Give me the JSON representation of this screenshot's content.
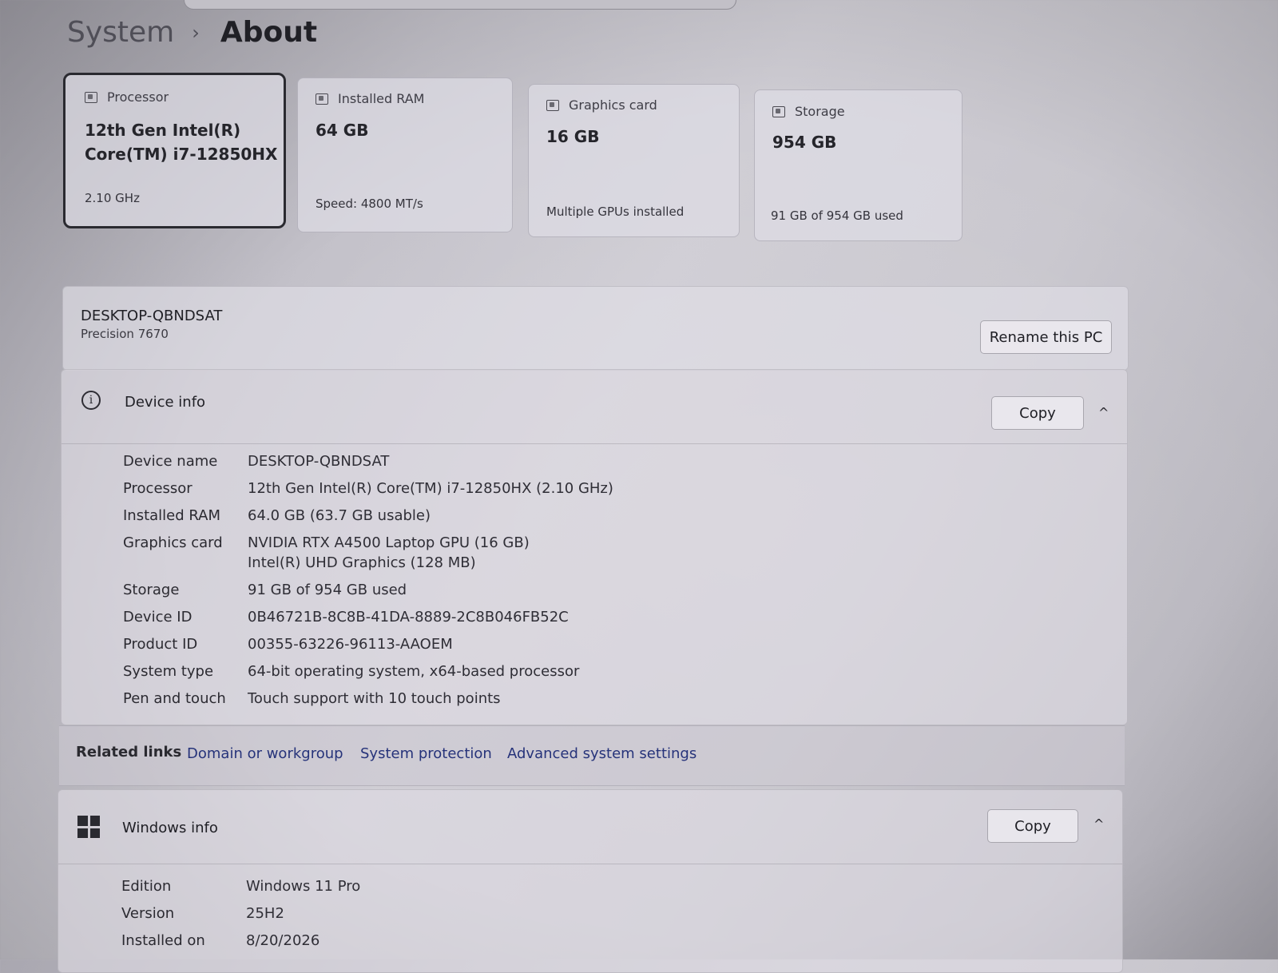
{
  "breadcrumb": {
    "parent": "System",
    "separator": "›",
    "current": "About"
  },
  "spec_cards": [
    {
      "icon": "processor-icon",
      "label": "Processor",
      "value_line1": "12th Gen Intel(R)",
      "value_line2": "Core(TM) i7-12850HX",
      "sub": "2.10 GHz",
      "selected": true
    },
    {
      "icon": "memory-icon",
      "label": "Installed RAM",
      "value_line1": "64 GB",
      "value_line2": "",
      "sub": "Speed: 4800 MT/s",
      "selected": false
    },
    {
      "icon": "graphics-card-icon",
      "label": "Graphics card",
      "value_line1": "16 GB",
      "value_line2": "",
      "sub": "Multiple GPUs installed",
      "selected": false
    },
    {
      "icon": "storage-icon",
      "label": "Storage",
      "value_line1": "954 GB",
      "value_line2": "",
      "sub": "91 GB of 954 GB used",
      "selected": false
    }
  ],
  "pc": {
    "name": "DESKTOP-QBNDSAT",
    "model": "Precision 7670",
    "rename_label": "Rename this PC"
  },
  "device_info": {
    "title": "Device info",
    "copy_label": "Copy",
    "chevron": "^",
    "rows": [
      {
        "label": "Device name",
        "value": "DESKTOP-QBNDSAT",
        "value2": ""
      },
      {
        "label": "Processor",
        "value": "12th Gen Intel(R) Core(TM) i7-12850HX (2.10 GHz)",
        "value2": ""
      },
      {
        "label": "Installed RAM",
        "value": "64.0 GB (63.7 GB usable)",
        "value2": ""
      },
      {
        "label": "Graphics card",
        "value": "NVIDIA RTX A4500 Laptop GPU (16 GB)",
        "value2": "Intel(R) UHD Graphics (128 MB)"
      },
      {
        "label": "Storage",
        "value": "91 GB of 954 GB used",
        "value2": ""
      },
      {
        "label": "Device ID",
        "value": "0B46721B-8C8B-41DA-8889-2C8B046FB52C",
        "value2": ""
      },
      {
        "label": "Product ID",
        "value": "00355-63226-96113-AAOEM",
        "value2": ""
      },
      {
        "label": "System type",
        "value": "64-bit operating system, x64-based processor",
        "value2": ""
      },
      {
        "label": "Pen and touch",
        "value": "Touch support with 10 touch points",
        "value2": ""
      }
    ]
  },
  "related_links": {
    "label": "Related links",
    "links": [
      "Domain or workgroup",
      "System protection",
      "Advanced system settings"
    ]
  },
  "windows_info": {
    "title": "Windows info",
    "copy_label": "Copy",
    "chevron": "^",
    "rows": [
      {
        "label": "Edition",
        "value": "Windows 11 Pro"
      },
      {
        "label": "Version",
        "value": "25H2"
      },
      {
        "label": "Installed on",
        "value": "8/20/2026"
      }
    ]
  }
}
